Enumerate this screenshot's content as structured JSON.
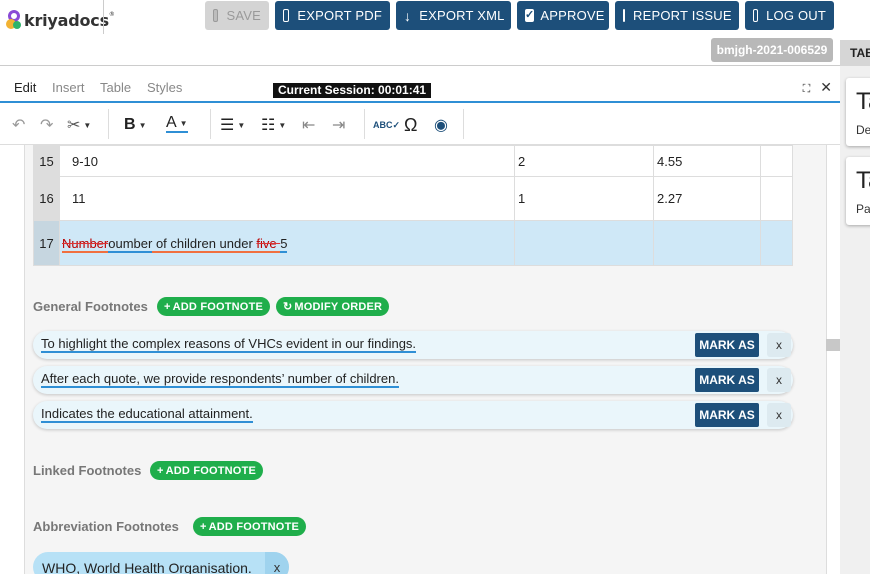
{
  "brand": {
    "logo_text": "kriyadocs",
    "trademark": "®"
  },
  "top_actions": {
    "save": "SAVE",
    "export_pdf": "EXPORT PDF",
    "export_xml": "EXPORT XML",
    "approve": "APPROVE",
    "report_issue": "REPORT ISSUE",
    "logout": "LOG OUT"
  },
  "doc_id": "bmjgh-2021-006529",
  "side_tab": "TAB",
  "editor_menu": {
    "edit": "Edit",
    "insert": "Insert",
    "table": "Table",
    "styles": "Styles"
  },
  "session": "Current Session: 00:01:41",
  "window_icons": {
    "expand": "⛶",
    "close": "✕"
  },
  "toolbar": [
    "undo-icon",
    "redo-icon",
    "cut-icon",
    "bold-icon",
    "font-color-icon",
    "bullet-list-icon",
    "numbered-list-icon",
    "outdent-icon",
    "indent-icon",
    "spellcheck-icon",
    "special-char-icon",
    "preview-icon"
  ],
  "table_rows": [
    {
      "num": "15",
      "c1": "9-10",
      "c2": "2",
      "c3": "4.55",
      "c4": ""
    },
    {
      "num": "16",
      "c1": "11",
      "c2": "1",
      "c3": "2.27",
      "c4": ""
    }
  ],
  "selected_row": {
    "num": "17",
    "deleted_1": "Number",
    "text_1": "oumber",
    "text_2": " of children under ",
    "deleted_2": "five ",
    "text_3": "5"
  },
  "general_footnotes": {
    "title": "General Footnotes",
    "add": "ADD FOOTNOTE",
    "modify": "MODIFY ORDER",
    "items": [
      "To highlight the complex reasons of VHCs evident in our findings.",
      "After each quote, we provide respondents’ number of children.",
      "Indicates the educational attainment."
    ],
    "mark_label": "MARK AS",
    "remove_label": "x"
  },
  "linked_footnotes": {
    "title": "Linked Footnotes",
    "add": "ADD FOOTNOTE"
  },
  "abbreviation_footnotes": {
    "title": "Abbreviation Footnotes",
    "add": "ADD FOOTNOTE",
    "chip": "WHO, World Health Organisation.",
    "chip_remove": "x"
  },
  "right_cards": [
    {
      "big": "Ta",
      "small": "De"
    },
    {
      "big": "Ta",
      "small": "Pa"
    }
  ],
  "colors": {
    "primary": "#1d4f7a",
    "green": "#1fae4b",
    "accent_blue": "#2f8fd5",
    "selected_row": "#cfe8f7"
  }
}
